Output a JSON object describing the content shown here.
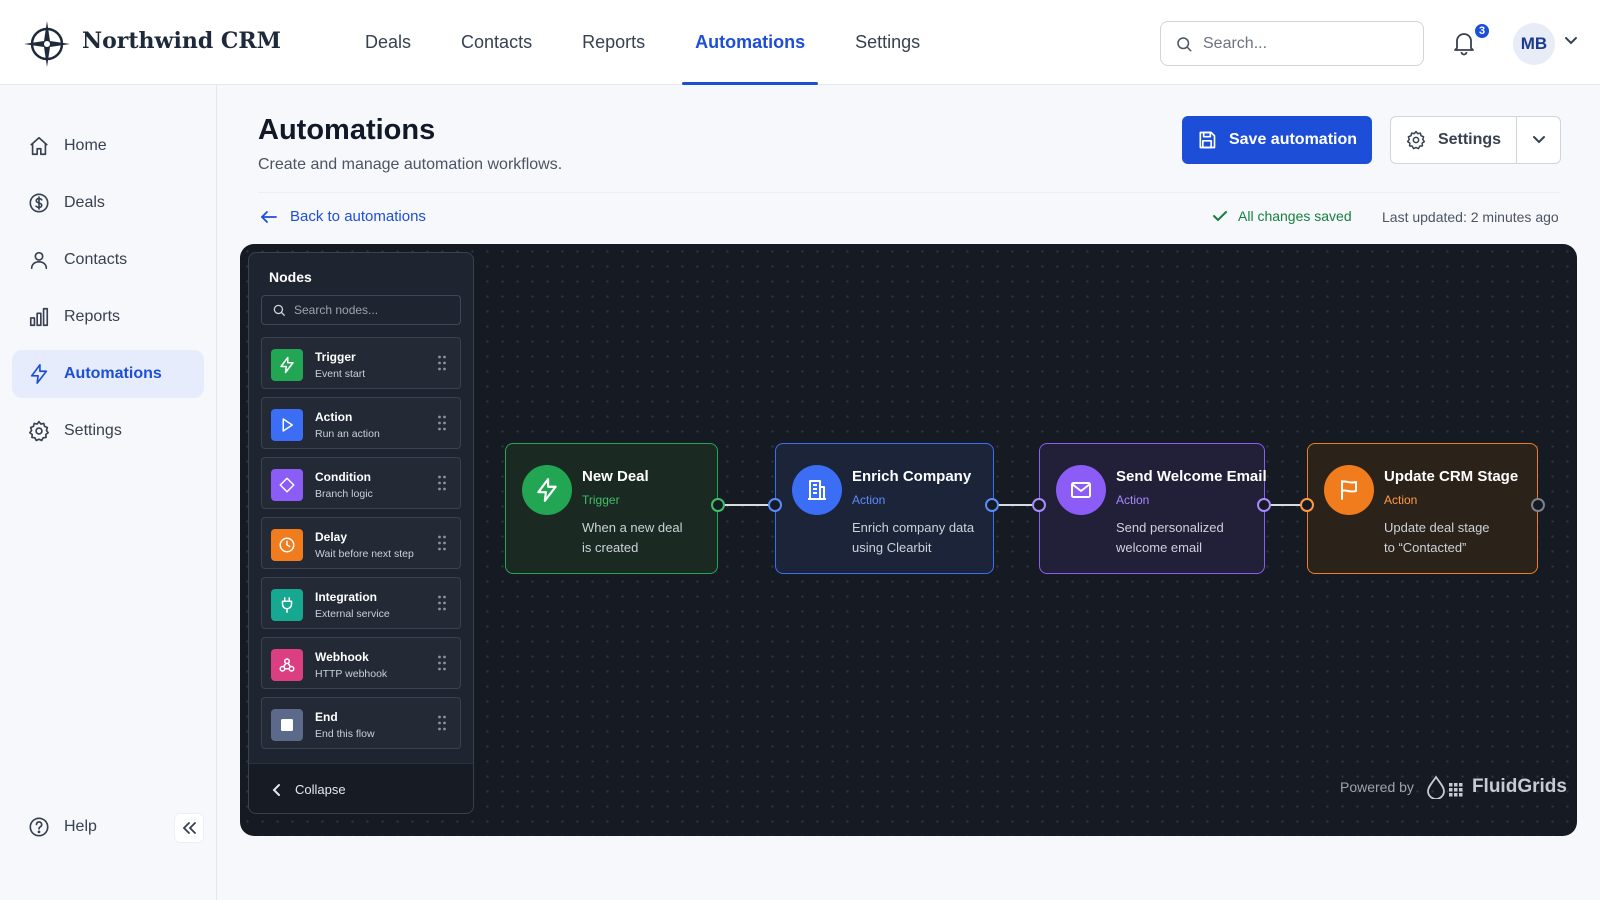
{
  "app": {
    "brand": "Northwind CRM"
  },
  "topnav": {
    "items": [
      {
        "label": "Deals"
      },
      {
        "label": "Contacts"
      },
      {
        "label": "Reports"
      },
      {
        "label": "Automations",
        "active": true
      },
      {
        "label": "Settings"
      }
    ]
  },
  "search": {
    "placeholder": "Search..."
  },
  "notifications": {
    "count": "3"
  },
  "user": {
    "initials": "MB"
  },
  "sidebar": {
    "items": [
      {
        "label": "Home",
        "icon": "home-icon"
      },
      {
        "label": "Deals",
        "icon": "dollar-icon"
      },
      {
        "label": "Contacts",
        "icon": "user-icon"
      },
      {
        "label": "Reports",
        "icon": "bar-chart-icon"
      },
      {
        "label": "Automations",
        "icon": "lightning-icon",
        "active": true
      },
      {
        "label": "Settings",
        "icon": "gear-icon"
      }
    ],
    "help": "Help"
  },
  "header": {
    "title": "Automations",
    "subtitle": "Create and manage automation workflows.",
    "save_label": "Save automation",
    "settings_label": "Settings",
    "back_label": "Back to automations",
    "saved_status": "All changes saved",
    "last_updated": "Last updated: 2 minutes ago"
  },
  "palette": {
    "title": "Nodes",
    "search_placeholder": "Search nodes...",
    "items": [
      {
        "name": "Trigger",
        "desc": "Event start",
        "color": "#22a653",
        "icon": "lightning-icon"
      },
      {
        "name": "Action",
        "desc": "Run an action",
        "color": "#3b6ef5",
        "icon": "play-icon"
      },
      {
        "name": "Condition",
        "desc": "Branch logic",
        "color": "#8b5cf6",
        "icon": "diamond-icon"
      },
      {
        "name": "Delay",
        "desc": "Wait before next step",
        "color": "#f07c1e",
        "icon": "clock-icon"
      },
      {
        "name": "Integration",
        "desc": "External service",
        "color": "#17a892",
        "icon": "plug-icon"
      },
      {
        "name": "Webhook",
        "desc": "HTTP webhook",
        "color": "#db3f82",
        "icon": "webhook-icon"
      },
      {
        "name": "End",
        "desc": "End this flow",
        "color": "#5b6a8a",
        "icon": "stop-icon"
      }
    ],
    "collapse_label": "Collapse"
  },
  "flow": {
    "nodes": [
      {
        "title": "New Deal",
        "type": "Trigger",
        "desc1": "When a new deal",
        "desc2": "is created",
        "color": "#22a653",
        "icon": "lightning-icon"
      },
      {
        "title": "Enrich Company",
        "type": "Action",
        "desc1": "Enrich company data",
        "desc2": "using Clearbit",
        "color": "#3b6ef5",
        "icon": "building-icon"
      },
      {
        "title": "Send Welcome Email",
        "type": "Action",
        "desc1": "Send personalized",
        "desc2": "welcome email",
        "color": "#8b5cf6",
        "icon": "mail-icon"
      },
      {
        "title": "Update CRM Stage",
        "type": "Action",
        "desc1": "Update deal stage",
        "desc2": "to “Contacted”",
        "color": "#f07c1e",
        "icon": "flag-icon"
      }
    ]
  },
  "footer": {
    "powered_by": "Powered by",
    "brand": "FluidGrids"
  }
}
